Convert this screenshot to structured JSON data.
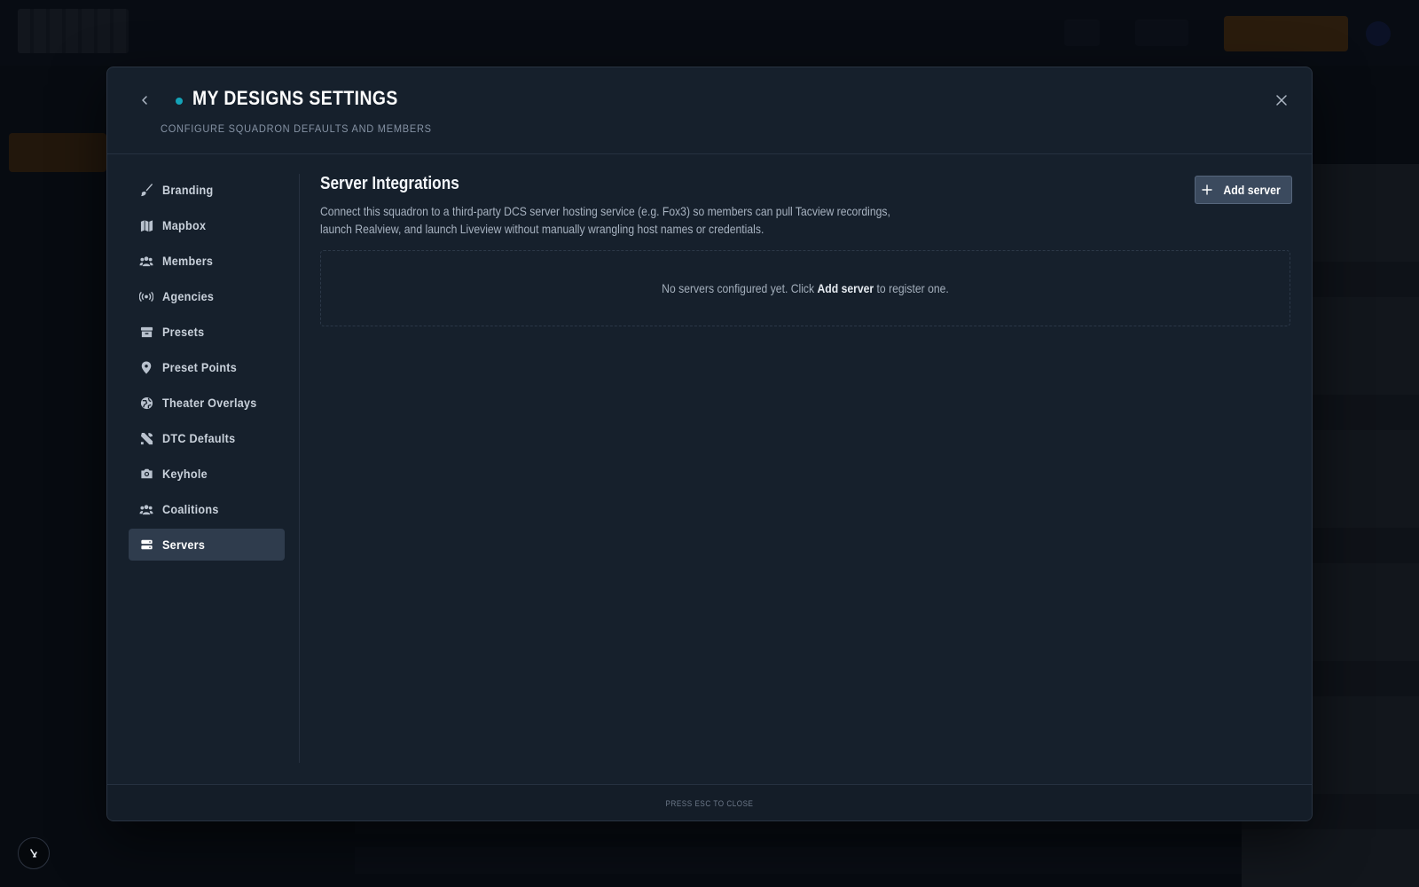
{
  "modal": {
    "title": "MY DESIGNS SETTINGS",
    "subtitle": "CONFIGURE SQUADRON DEFAULTS AND MEMBERS",
    "back_icon": "chevron-left-icon",
    "close_icon": "close-icon",
    "accent_color": "#14a3b8",
    "footer_hint": "PRESS ESC TO CLOSE"
  },
  "nav": {
    "items": [
      {
        "label": "Branding",
        "icon": "brush-icon"
      },
      {
        "label": "Mapbox",
        "icon": "map-icon"
      },
      {
        "label": "Members",
        "icon": "users-icon"
      },
      {
        "label": "Agencies",
        "icon": "broadcast-icon"
      },
      {
        "label": "Presets",
        "icon": "archive-icon"
      },
      {
        "label": "Preset Points",
        "icon": "map-pin-icon"
      },
      {
        "label": "Theater Overlays",
        "icon": "globe-icon"
      },
      {
        "label": "DTC Defaults",
        "icon": "tools-icon"
      },
      {
        "label": "Keyhole",
        "icon": "camera-icon"
      },
      {
        "label": "Coalitions",
        "icon": "users-group-icon"
      },
      {
        "label": "Servers",
        "icon": "server-icon"
      }
    ],
    "active": "Servers"
  },
  "servers": {
    "title": "Server Integrations",
    "description": "Connect this squadron to a third-party DCS server hosting service (e.g. Fox3) so members can pull Tacview recordings, launch Realview, and launch Liveview without manually wrangling host names or credentials.",
    "add_button_label": "Add server",
    "empty_prefix": "No servers configured yet. Click ",
    "empty_action": "Add server",
    "empty_suffix": " to register one."
  }
}
